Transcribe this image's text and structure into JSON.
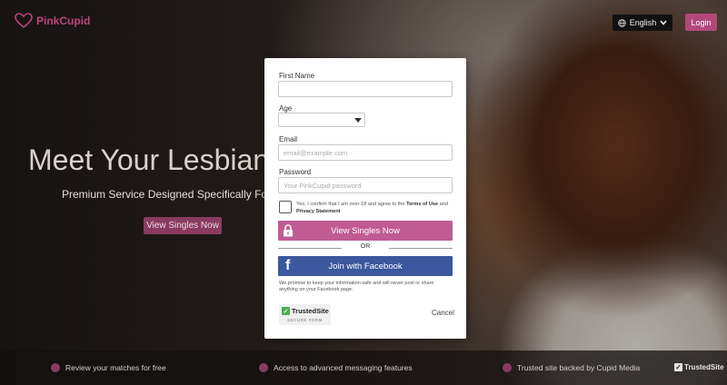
{
  "header": {
    "logo_text": "PinkCupid",
    "language": "English",
    "login_label": "Login"
  },
  "hero": {
    "title": "Meet Your Lesbian M",
    "subtitle": "Premium Service Designed Specifically For L",
    "cta_label": "View Singles Now"
  },
  "modal": {
    "first_name_label": "First Name",
    "first_name_value": "",
    "age_label": "Age",
    "age_value": "",
    "email_label": "Email",
    "email_placeholder": "email@example.com",
    "password_label": "Password",
    "password_placeholder": "Your PinkCupid password",
    "terms_prefix": "Yes, I confirm that I am over 18 and agree to the ",
    "terms_of_use": "Terms of Use",
    "terms_and": " and ",
    "privacy_statement": "Privacy Statement",
    "submit_label": "View Singles Now",
    "or_label": "OR",
    "facebook_label": "Join with Facebook",
    "facebook_glyph": "f",
    "promise_text": "We promise to keep your information safe and will never post or share anything on your Facebook page.",
    "badge_title": "TrustedSite",
    "badge_subtitle": "SECURE FORM",
    "cancel_label": "Cancel"
  },
  "footer": {
    "features": [
      {
        "label": "Review your matches for free"
      },
      {
        "label": "Access to advanced messaging features"
      },
      {
        "label": "Trusted site backed by Cupid Media"
      }
    ],
    "trusted_badge": "TrustedSite"
  },
  "colors": {
    "brand_pink": "#c05b94",
    "facebook_blue": "#3b579d",
    "login_bg": "#b2487a"
  }
}
